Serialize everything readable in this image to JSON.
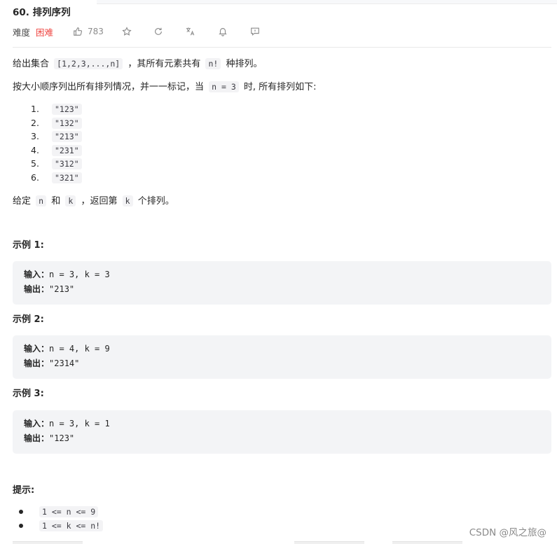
{
  "problem": {
    "title": "60. 排列序列",
    "difficulty_label": "难度",
    "difficulty": "困难",
    "likes": "783"
  },
  "toolbar": {
    "icons": [
      "thumbs-up-icon",
      "star-icon",
      "refresh-icon",
      "translate-icon",
      "bell-icon",
      "feedback-icon"
    ]
  },
  "description": {
    "p1_pre": "给出集合",
    "p1_code1": "[1,2,3,...,n]",
    "p1_mid": "，其所有元素共有",
    "p1_code2": "n!",
    "p1_post": "种排列。",
    "p2_pre": "按大小顺序列出所有排列情况，并一一标记，当",
    "p2_code": "n = 3",
    "p2_post": "时, 所有排列如下:",
    "permutations": [
      {
        "num": "1.",
        "value": "\"123\""
      },
      {
        "num": "2.",
        "value": "\"132\""
      },
      {
        "num": "3.",
        "value": "\"213\""
      },
      {
        "num": "4.",
        "value": "\"231\""
      },
      {
        "num": "5.",
        "value": "\"312\""
      },
      {
        "num": "6.",
        "value": "\"321\""
      }
    ],
    "p3_pre": "给定",
    "p3_code1": "n",
    "p3_mid1": "和",
    "p3_code2": "k",
    "p3_mid2": "，返回第",
    "p3_code3": "k",
    "p3_post": "个排列。"
  },
  "examples": [
    {
      "title": "示例 1:",
      "input_label": "输入：",
      "input": "n = 3, k = 3",
      "output_label": "输出：",
      "output": "\"213\""
    },
    {
      "title": "示例 2:",
      "input_label": "输入：",
      "input": "n = 4, k = 9",
      "output_label": "输出：",
      "output": "\"2314\""
    },
    {
      "title": "示例 3:",
      "input_label": "输入：",
      "input": "n = 3, k = 1",
      "output_label": "输出：",
      "output": "\"123\""
    }
  ],
  "hints": {
    "title": "提示:",
    "items": [
      "1 <= n <= 9",
      "1 <= k <= n!"
    ]
  },
  "watermark": "CSDN @风之旅@"
}
